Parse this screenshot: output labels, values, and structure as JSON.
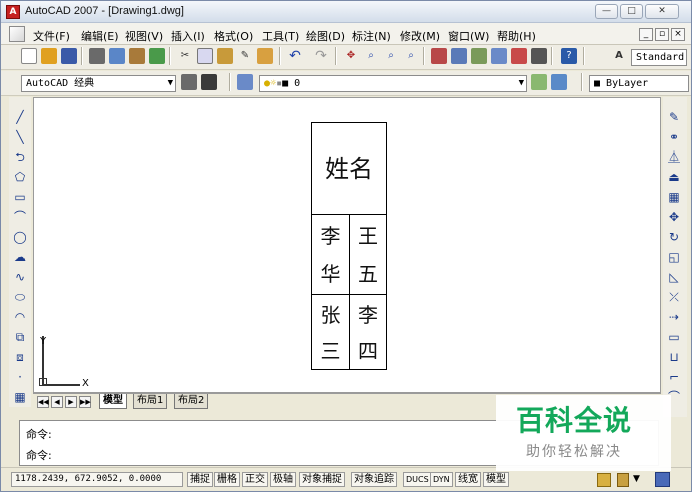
{
  "window": {
    "title": "AutoCAD 2007 - [Drawing1.dwg]"
  },
  "menu": [
    "文件(F)",
    "编辑(E)",
    "视图(V)",
    "插入(I)",
    "格式(O)",
    "工具(T)",
    "绘图(D)",
    "标注(N)",
    "修改(M)",
    "窗口(W)",
    "帮助(H)"
  ],
  "toolbar": {
    "text_style": "Standard",
    "workspace": "AutoCAD 经典",
    "layer": "0",
    "color": "ByLayer"
  },
  "drawing": {
    "header": "姓名",
    "row1": {
      "left": [
        "李",
        "华"
      ],
      "right": [
        "王",
        "五"
      ]
    },
    "row2": {
      "left": [
        "张",
        "三"
      ],
      "right": [
        "李",
        "四"
      ]
    },
    "axis_y": "Y",
    "axis_x": "X"
  },
  "tabs": [
    "模型",
    "布局1",
    "布局2"
  ],
  "command": {
    "prompt1": "命令:",
    "prompt2": "命令:"
  },
  "status": {
    "coords": "1178.2439, 672.9052, 0.0000",
    "buttons": [
      "捕捉",
      "栅格",
      "正交",
      "极轴",
      "对象捕捉",
      "对象追踪",
      "DUCS",
      "DYN",
      "线宽",
      "模型"
    ]
  },
  "watermark": {
    "main": "百科全说",
    "sub": "助你轻松解决"
  },
  "colors": {
    "accent": "#13a85a"
  }
}
